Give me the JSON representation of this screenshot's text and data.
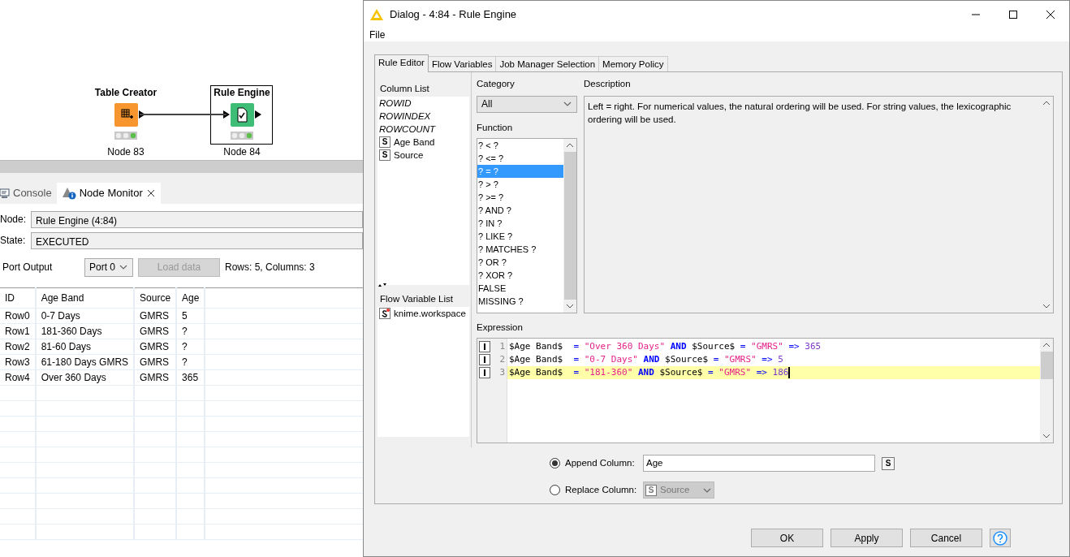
{
  "workflow": {
    "nodes": [
      {
        "title": "Table Creator",
        "label": "Node 83",
        "kind": "source",
        "selected": false
      },
      {
        "title": "Rule Engine",
        "label": "Node 84",
        "kind": "rule",
        "selected": true
      }
    ]
  },
  "bottom_panel": {
    "tabs": [
      {
        "label": "Console",
        "kind": "console",
        "selected": false
      },
      {
        "label": "Node Monitor",
        "kind": "monitor",
        "selected": true
      }
    ],
    "node": {
      "label": "Node:",
      "value": "Rule Engine  (4:84)"
    },
    "state": {
      "label": "State:",
      "value": "EXECUTED"
    },
    "port_output": {
      "label": "Port Output",
      "port": "Port 0",
      "load_button": "Load data",
      "load_disabled": true,
      "summary": "Rows: 5, Columns: 3"
    },
    "table": {
      "columns": [
        "ID",
        "Age Band",
        "Source",
        "Age"
      ],
      "rows": [
        [
          "Row0",
          "0-7 Days",
          "GMRS",
          "5"
        ],
        [
          "Row1",
          "181-360 Days",
          "GMRS",
          "?"
        ],
        [
          "Row2",
          "81-60 Days",
          "GMRS",
          "?"
        ],
        [
          "Row3",
          "61-180 Days GMRS",
          "GMRS",
          "?"
        ],
        [
          "Row4",
          "Over 360 Days",
          "GMRS",
          "365"
        ]
      ]
    }
  },
  "dialog": {
    "title": "Dialog - 4:84 - Rule Engine",
    "menu": [
      "File"
    ],
    "tabs": [
      {
        "label": "Rule Editor",
        "selected": true
      },
      {
        "label": "Flow Variables",
        "selected": false
      },
      {
        "label": "Job Manager Selection",
        "selected": false
      },
      {
        "label": "Memory Policy",
        "selected": false
      }
    ],
    "column_list": {
      "title": "Column List",
      "items": [
        {
          "name": "ROWID",
          "kind": "special"
        },
        {
          "name": "ROWINDEX",
          "kind": "special"
        },
        {
          "name": "ROWCOUNT",
          "kind": "special"
        },
        {
          "name": "Age Band",
          "kind": "column",
          "type": "S"
        },
        {
          "name": "Source",
          "kind": "column",
          "type": "S"
        }
      ]
    },
    "flow_variable_list": {
      "title": "Flow Variable List",
      "items": [
        "knime.workspace"
      ]
    },
    "category": {
      "label": "Category",
      "value": "All"
    },
    "function": {
      "label": "Function",
      "items": [
        {
          "text": "? < ?",
          "selected": false
        },
        {
          "text": "? <= ?",
          "selected": false
        },
        {
          "text": "? = ?",
          "selected": true
        },
        {
          "text": "? > ?",
          "selected": false
        },
        {
          "text": "? >= ?",
          "selected": false
        },
        {
          "text": "? AND ?",
          "selected": false
        },
        {
          "text": "? IN ?",
          "selected": false
        },
        {
          "text": "? LIKE ?",
          "selected": false
        },
        {
          "text": "? MATCHES ?",
          "selected": false
        },
        {
          "text": "? OR ?",
          "selected": false
        },
        {
          "text": "? XOR ?",
          "selected": false
        },
        {
          "text": "FALSE",
          "selected": false
        },
        {
          "text": "MISSING ?",
          "selected": false
        }
      ]
    },
    "description": {
      "label": "Description",
      "text": "Left = right. For numerical values, the natural ordering will be used. For string values, the lexicographic ordering will be used."
    },
    "expression": {
      "label": "Expression",
      "lines": [
        {
          "number": "1",
          "current": false,
          "tokens": [
            {
              "kind": "column",
              "text": "$Age Band$ "
            },
            {
              "kind": "op",
              "text": "="
            },
            {
              "kind": "string",
              "text": "\"Over 360 Days\""
            },
            {
              "kind": "keyword",
              "text": "AND"
            },
            {
              "kind": "column",
              "text": "$Source$"
            },
            {
              "kind": "op",
              "text": "="
            },
            {
              "kind": "string",
              "text": "\"GMRS\""
            },
            {
              "kind": "op",
              "text": "=>"
            },
            {
              "kind": "number",
              "text": "365"
            }
          ]
        },
        {
          "number": "2",
          "current": false,
          "tokens": [
            {
              "kind": "column",
              "text": "$Age Band$ "
            },
            {
              "kind": "op",
              "text": "="
            },
            {
              "kind": "string",
              "text": "\"0-7 Days\""
            },
            {
              "kind": "keyword",
              "text": "AND"
            },
            {
              "kind": "column",
              "text": "$Source$"
            },
            {
              "kind": "op",
              "text": "="
            },
            {
              "kind": "string",
              "text": "\"GMRS\""
            },
            {
              "kind": "op",
              "text": "=>"
            },
            {
              "kind": "number",
              "text": "5"
            }
          ]
        },
        {
          "number": "3",
          "current": true,
          "tokens": [
            {
              "kind": "column",
              "text": "$Age Band$ "
            },
            {
              "kind": "op",
              "text": "="
            },
            {
              "kind": "string",
              "text": "\"181-360\""
            },
            {
              "kind": "keyword",
              "text": "AND"
            },
            {
              "kind": "column",
              "text": "$Source$"
            },
            {
              "kind": "op",
              "text": "="
            },
            {
              "kind": "string",
              "text": "\"GMRS\""
            },
            {
              "kind": "op",
              "text": "=>"
            },
            {
              "kind": "number",
              "text": "186"
            }
          ]
        }
      ]
    },
    "output": {
      "options": [
        {
          "kind": "append",
          "label": "Append Column:",
          "selected": true,
          "value": "Age",
          "type": "S"
        },
        {
          "kind": "replace",
          "label": "Replace Column:",
          "selected": false,
          "value": "Source",
          "type": "S"
        }
      ]
    },
    "buttons": [
      "OK",
      "Apply",
      "Cancel"
    ]
  }
}
